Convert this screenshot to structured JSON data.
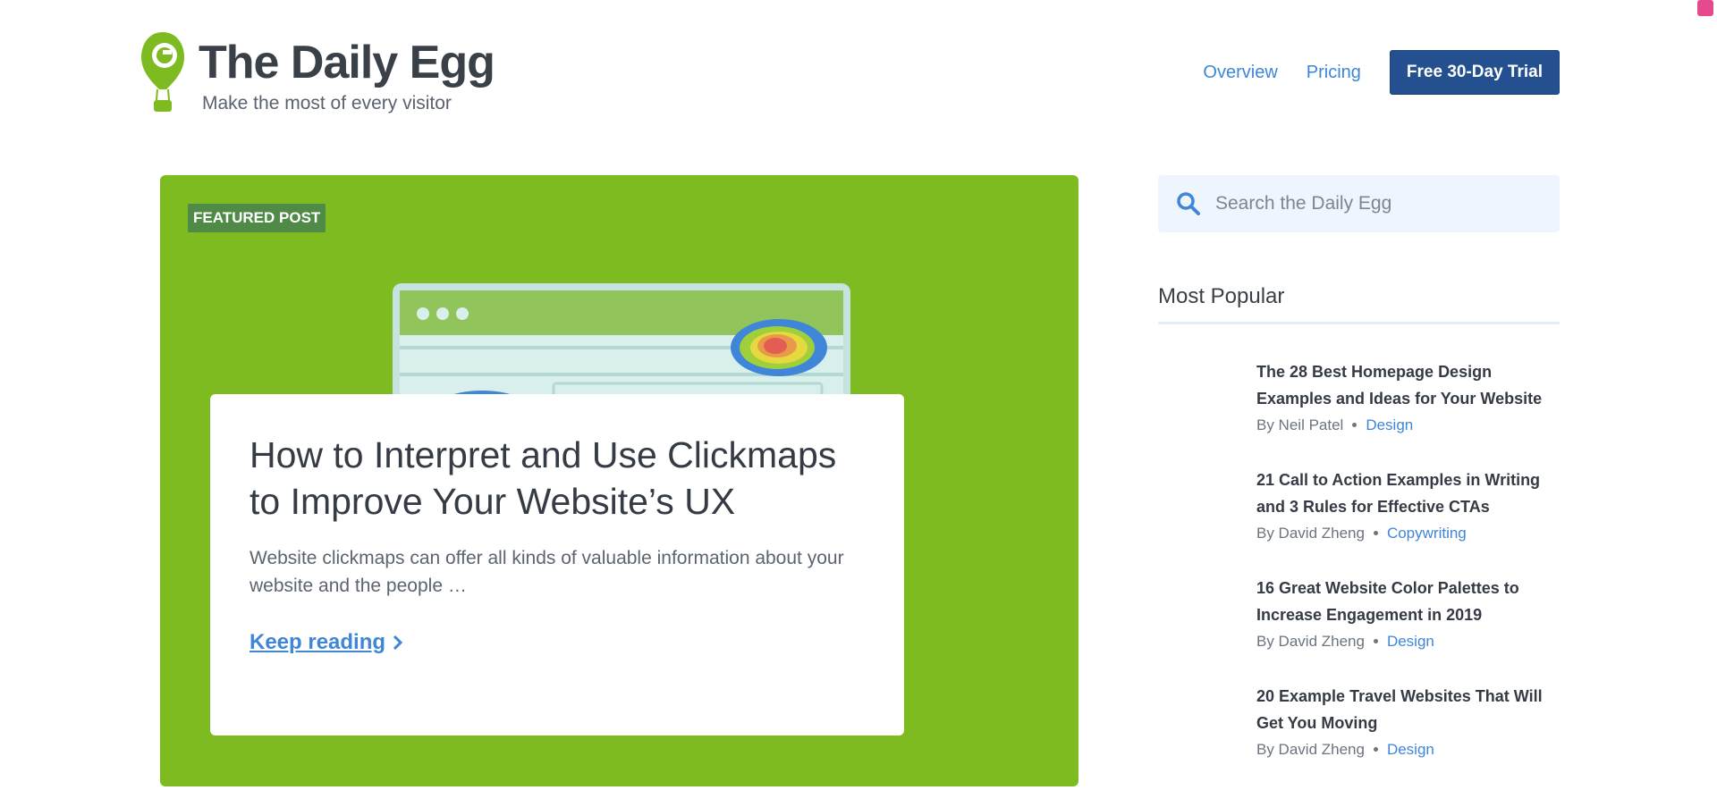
{
  "brand": {
    "title": "The Daily Egg",
    "tagline": "Make the most of every visitor",
    "logo_icon": "balloon-logo-icon",
    "color": "#7dbb21"
  },
  "nav": {
    "items": [
      "Overview",
      "Pricing"
    ],
    "cta": "Free 30-Day Trial",
    "cta_color": "#24508f"
  },
  "featured": {
    "badge": "FEATURED POST",
    "title": "How to Interpret and Use Clickmaps to Improve Your Website’s UX",
    "excerpt": "Website clickmaps can offer all kinds of valuable information about your website and the people …",
    "link": "Keep reading",
    "background": "#7dbb21"
  },
  "search": {
    "placeholder": "Search the Daily Egg",
    "icon": "search-icon"
  },
  "popular": {
    "heading": "Most Popular",
    "items": [
      {
        "title": "The 28 Best Homepage Design Examples and Ideas for Your Website",
        "author": "By Neil Patel",
        "category": "Design"
      },
      {
        "title": "21 Call to Action Examples in Writing and 3 Rules for Effective CTAs",
        "author": "By David Zheng",
        "category": "Copywriting"
      },
      {
        "title": "16 Great Website Color Palettes to Increase Engagement in 2019",
        "author": "By David Zheng",
        "category": "Design"
      },
      {
        "title": "20 Example Travel Websites That Will Get You Moving",
        "author": "By David Zheng",
        "category": "Design"
      }
    ]
  }
}
